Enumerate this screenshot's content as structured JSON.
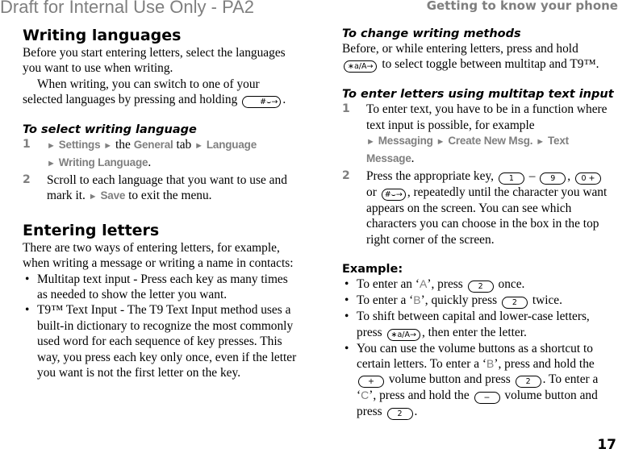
{
  "watermark": "Draft for Internal Use Only - PA2",
  "running_head": "Getting to know your phone",
  "page_number": "17",
  "keys": {
    "hash": "#⌣→",
    "star": "∗a/A→",
    "k1": "1",
    "k9": "9",
    "k0": "0 +",
    "k2": "2",
    "plus": "+",
    "minus": "−"
  },
  "arrow": "►",
  "left": {
    "writing_languages": {
      "title": "Writing languages",
      "p1": "Before you start entering letters, select the languages you want to use when writing.",
      "p2": "When writing, you can switch to one of your selected languages by pressing and holding",
      "p2_end": "."
    },
    "select_language": {
      "title": "To select writing language",
      "steps": [
        {
          "num": "1",
          "menu1": "Settings",
          "t1": "the",
          "menu2": "General",
          "t2": "tab",
          "menu3": "Language",
          "menu4": "Writing Language",
          "end": "."
        },
        {
          "num": "2",
          "text": "Scroll to each language that you want to use and mark it.",
          "menu": "Save",
          "end": "to exit the menu."
        }
      ]
    },
    "entering_letters": {
      "title": "Entering letters",
      "intro": "There are two ways of entering letters, for example, when writing a message or writing a name in contacts:",
      "bullets": [
        "Multitap text input - Press each key as many times as needed to show the letter you want.",
        "T9™ Text Input - The T9 Text Input method uses a built-in dictionary to recognize the most commonly used word for each sequence of key presses. This way, you press each key only once, even if the letter you want is not the first letter on the key."
      ]
    }
  },
  "right": {
    "change_methods": {
      "title": "To change writing methods",
      "p1": "Before, or while entering letters, press and hold",
      "p1_end": "to select toggle between multitap and T9™."
    },
    "multitap": {
      "title": "To enter letters using multitap text input",
      "step1": {
        "num": "1",
        "text": "To enter text, you have to be in a function where text input is possible, for example",
        "menu1": "Messaging",
        "menu2": "Create New Msg.",
        "menu3": "Text Message",
        "end": "."
      },
      "step2": {
        "num": "2",
        "t1": "Press the appropriate key,",
        "dash": "–",
        "comma": ",",
        "or": "or",
        "t2": ", repeatedly until the character you want appears on the screen. You can see which characters you can choose in the box in the top right corner of the screen."
      }
    },
    "example": {
      "title": "Example:",
      "b1_a": "To enter an ‘",
      "b1_letter": "A",
      "b1_b": "’, press",
      "b1_c": "once.",
      "b2_a": "To enter a ‘",
      "b2_letter": "B",
      "b2_b": "’, quickly press",
      "b2_c": "twice.",
      "b3_a": "To shift between capital and lower-case letters, press",
      "b3_b": ", then enter the letter.",
      "b4_a": "You can use the volume buttons as a shortcut to certain letters. To enter a ‘",
      "b4_letter1": "B",
      "b4_b": "’, press and hold the",
      "b4_c": "volume button and press",
      "b4_d": ". To enter a ‘",
      "b4_letter2": "C",
      "b4_e": "’, press and hold the",
      "b4_f": "volume button and press",
      "b4_g": ".",
      "bullet": "•"
    }
  }
}
